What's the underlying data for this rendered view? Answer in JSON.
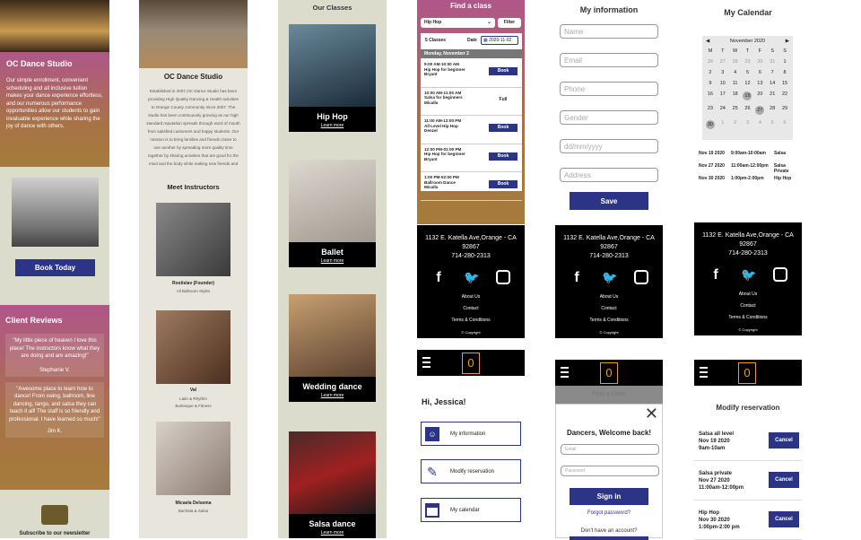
{
  "col1": {
    "studio_title": "OC Dance Studio",
    "intro": "Our simple enrollment, convenient scheduling and all inclusive tuition makes your dance experience effortless, and our numerous performance opportunities allow our students to gain invaluable experience while sharing the joy of dance with others.",
    "book_today": "Book Today",
    "reviews_title": "Client Reviews",
    "review1": "\"My little piece of heaven I love this place! The instructors know what they are doing and are amazing!\"",
    "review1_author": "Stephanie V.",
    "review2": "\"Awesome place to learn how to dance! From swing, ballroom, line dancing, tango, and salsa they can teach it all! The staff is so friendly and professional. I have learned so much!\"",
    "review2_author": "Jim K.",
    "newsletter": "Subscribe to our newsletter"
  },
  "col2": {
    "studio_title": "OC Dance Studio",
    "about": "Established in 2007,OC Dance Studio has been providing High Quality Dancing & Health activities to Orange County community since 2007. The studio has been continuously growing as our high standard reputation spreads through word of mouth from satisfied customers and happy students. Our mission is to bring families and friends closer to one another by spreading more quality time together by sharing activities that are good for the mind and the body while making new friends and exploring new ways of",
    "instructors_title": "Meet Instructors",
    "instructors": [
      {
        "name": "Rostislav (Founder)",
        "style": "All Ballroom Styles"
      },
      {
        "name": "Val",
        "style": "Latin & Rhythm\nBurlesque & Fitness"
      },
      {
        "name": "Micaela Delsema",
        "style": "Bachata & Salsa"
      }
    ]
  },
  "col3": {
    "title": "Our Classes",
    "classes": [
      {
        "name": "Hip Hop",
        "link": "Learn more"
      },
      {
        "name": "Ballet",
        "link": "Learn more"
      },
      {
        "name": "Wedding dance",
        "link": "Learn more"
      },
      {
        "name": "Salsa dance",
        "link": "Learn more"
      }
    ]
  },
  "col4": {
    "title": "Find a class",
    "select_value": "Hip Hop",
    "filter": "Filter",
    "count": "5 Classes",
    "date_label": "Date",
    "date_value": "2020-11-02",
    "day_header": "Monday, November 2",
    "slots": [
      {
        "time": "9:00 AM-10:00 AM",
        "name": "Hip Hop for beginner",
        "teacher": "Bryant",
        "action": "Book"
      },
      {
        "time": "10:00 AM-11:00 AM",
        "name": "Salsa for beginners",
        "teacher": "Micalla",
        "action": "Full"
      },
      {
        "time": "11:00 AM-12:00 PM",
        "name": "All Level Hip Hop",
        "teacher": "Denzel",
        "action": "Book"
      },
      {
        "time": "12:00 PM-01:00 PM",
        "name": "Hip Hop for beginner",
        "teacher": "Bryant",
        "action": "Book"
      },
      {
        "time": "1:00 PM-02:00 PM",
        "name": "Ballroom Dance",
        "teacher": "Micalla",
        "action": "Book"
      }
    ],
    "greeting": "Hi, Jessica!",
    "menu": [
      "My information",
      "Modify reservation",
      "My calendar"
    ]
  },
  "footer": {
    "address": "1132 E. Katella Ave,Orange - CA",
    "zip": "92867",
    "phone": "714-280-2313",
    "links": [
      "About Us",
      "Contact",
      "Terms & Conditions"
    ],
    "copyright": "© Copyright"
  },
  "logo_char": "0",
  "col5": {
    "title": "My information",
    "fields": [
      "Name",
      "Email",
      "Phone",
      "Gender",
      "dd/mm/yyyy",
      "Address"
    ],
    "save": "Save",
    "find_class_ghost": "Find a class",
    "login_title": "Dancers, Welcome back!",
    "email_ph": "Email",
    "password_ph": "Password",
    "sign_in": "Sign in",
    "forgot": "Forgot password?",
    "no_account": "Don't have an account?"
  },
  "col6": {
    "title": "My Calendar",
    "month": "November 2020",
    "weekdays": [
      "M",
      "T",
      "W",
      "T",
      "F",
      "S",
      "S"
    ],
    "weeks": [
      [
        "26",
        "27",
        "28",
        "29",
        "30",
        "31",
        "1"
      ],
      [
        "2",
        "3",
        "4",
        "5",
        "6",
        "7",
        "8"
      ],
      [
        "9",
        "10",
        "11",
        "12",
        "13",
        "14",
        "15"
      ],
      [
        "16",
        "17",
        "18",
        "19",
        "20",
        "21",
        "22"
      ],
      [
        "23",
        "24",
        "25",
        "26",
        "27",
        "28",
        "29"
      ],
      [
        "30",
        "1",
        "2",
        "3",
        "4",
        "5",
        "6"
      ]
    ],
    "events": [
      {
        "date": "Nov 19 2020",
        "time": "9:00am-10:00am",
        "cls": "Salsa"
      },
      {
        "date": "Nov 27 2020",
        "time": "11:00am-12:00pm",
        "cls": "Salsa Private"
      },
      {
        "date": "Nov 30 2020",
        "time": "1:00pm-2:00pm",
        "cls": "Hip Hop"
      }
    ],
    "modify_title": "Modify reservation",
    "reservations": [
      {
        "name": "Salsa all level",
        "date": "Nov 19 2020",
        "time": "9am-10am"
      },
      {
        "name": "Salsa private",
        "date": "Nov 27 2020",
        "time": "11:00am-12:00pm"
      },
      {
        "name": "Hip Hop",
        "date": "Nov 30 2020",
        "time": "1:00pm-2:00 pm"
      }
    ],
    "cancel": "Cancel"
  }
}
